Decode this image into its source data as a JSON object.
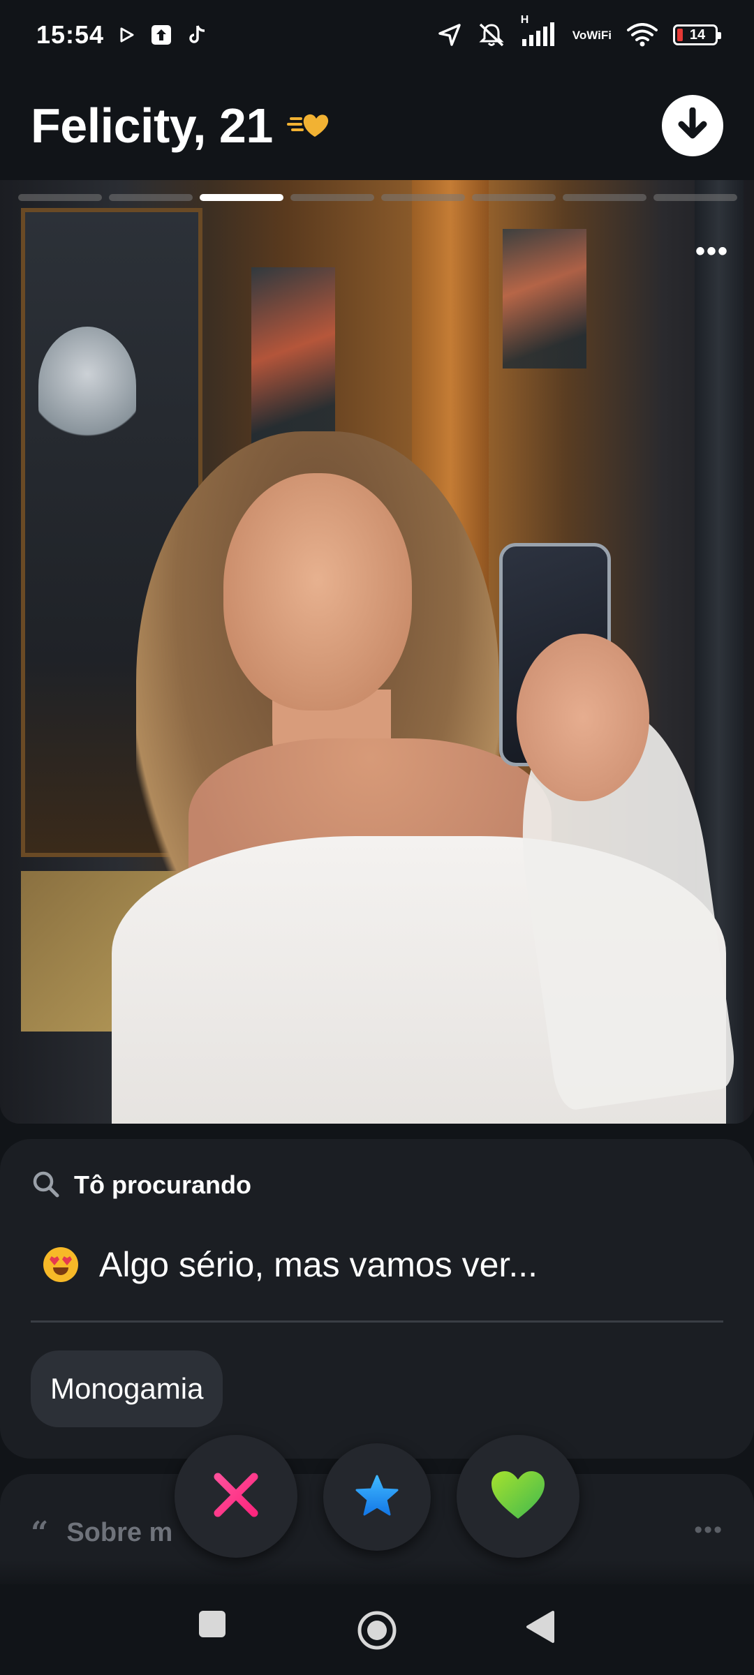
{
  "status_bar": {
    "time": "15:54",
    "battery": "14",
    "icons": [
      "play-icon",
      "upload-icon",
      "tiktok-icon",
      "location-icon",
      "mute-icon",
      "signal-icon",
      "volte-icon",
      "wifi-icon",
      "battery-icon"
    ],
    "volte_top": "Vo",
    "volte_bottom": "WiFi",
    "network_label": "H"
  },
  "header": {
    "name_age": "Felicity, 21",
    "badge_icon": "flying-heart-icon",
    "action_icon": "arrow-down-icon"
  },
  "photo": {
    "segments_total": 8,
    "active_segment": 3,
    "more_icon": "more-horizontal-icon"
  },
  "looking_for": {
    "label": "Tô procurando",
    "icon": "search-icon",
    "emoji": "heart-eyes-emoji",
    "value": "Algo sério, mas vamos ver...",
    "chip": "Monogamia"
  },
  "about": {
    "label": "Sobre m",
    "icon": "quote-icon",
    "more_icon": "more-horizontal-icon"
  },
  "actions": {
    "nope_icon": "close-icon",
    "super_icon": "star-icon",
    "like_icon": "heart-icon",
    "colors": {
      "nope": "#fd267d",
      "super": "#1e9bff",
      "like": "#7dd321"
    }
  },
  "nav": {
    "icons": [
      "recent-apps-icon",
      "home-icon",
      "back-icon"
    ]
  }
}
